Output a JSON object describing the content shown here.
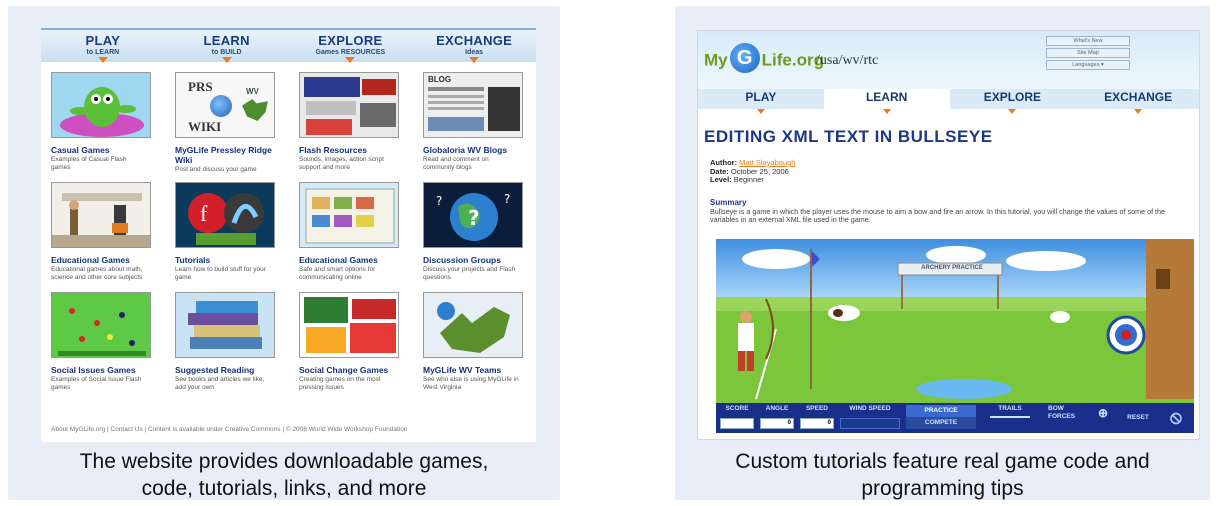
{
  "left": {
    "nav": [
      {
        "title": "PLAY",
        "sub": "to LEARN"
      },
      {
        "title": "LEARN",
        "sub": "to BUILD"
      },
      {
        "title": "EXPLORE",
        "sub": "Games RESOURCES"
      },
      {
        "title": "EXCHANGE",
        "sub": "Ideas"
      }
    ],
    "tiles": [
      {
        "title": "Casual Games",
        "desc": "Examples of Casual Flash games"
      },
      {
        "title": "MyGLife Pressley Ridge Wiki",
        "desc": "Post and discuss your game"
      },
      {
        "title": "Flash Resources",
        "desc": "Sounds, images, action script support and more"
      },
      {
        "title": "Globaloria WV Blogs",
        "desc": "Read and comment on community blogs"
      },
      {
        "title": "Educational Games",
        "desc": "Educational games about math, science and other core subjects"
      },
      {
        "title": "Tutorials",
        "desc": "Learn how to build stuff for your game"
      },
      {
        "title": "Educational Games",
        "desc": "Safe and smart options for communicating online"
      },
      {
        "title": "Discussion Groups",
        "desc": "Discuss your projects and Flash questions"
      },
      {
        "title": "Social Issues Games",
        "desc": "Examples of Social Issue Flash games"
      },
      {
        "title": "Suggested Reading",
        "desc": "See books and articles we like, add your own"
      },
      {
        "title": "Social Change Games",
        "desc": "Creating games on the most pressing issues"
      },
      {
        "title": "MyGLife WV Teams",
        "desc": "See who else is using MyGLife in West Virginia"
      }
    ],
    "thumb_text": {
      "prs": "PRS",
      "wiki": "WIKI",
      "wv": "WV",
      "blog": "BLOG"
    },
    "footer": "About MyGLife.org | Contact Us | Content is available under Creative Commons | © 2008 World Wide Workshop Foundation",
    "caption_line1": "The website provides downloadable games,",
    "caption_line2": "code, tutorials, links, and more"
  },
  "right": {
    "logo_my": "My",
    "logo_g": "G",
    "logo_rest": "Life.org",
    "path": "/usa/wv/rtc",
    "top_links": [
      "What's New",
      "Site Map",
      "Languages ▾"
    ],
    "nav": [
      "PLAY",
      "LEARN",
      "EXPLORE",
      "EXCHANGE"
    ],
    "title": "EDITING XML TEXT IN BULLSEYE",
    "author_label": "Author:",
    "author": "Matt Slayabaugh",
    "date_label": "Date:",
    "date": "October 25, 2006",
    "level_label": "Level:",
    "level": "Beginner",
    "summary_label": "Summary",
    "summary": "Bullseye is a game in which the player uses the mouse to aim a bow and fire an arrow. In this tutorial, you will change the values of some of the variables in an external XML file used in the game.",
    "banner": "ARCHERY PRACTICE",
    "hud": {
      "score": "SCORE",
      "angle": "ANGLE",
      "speed": "SPEED",
      "wind": "WIND SPEED",
      "practice": "PRACTICE",
      "compete": "COMPETE",
      "trails": "TRAILS",
      "bow": "BOW",
      "forces": "FORCES",
      "reset": "RESET",
      "angle_val": "0",
      "speed_val": "0"
    },
    "caption_line1": "Custom tutorials feature real game code and",
    "caption_line2": "programming tips"
  }
}
